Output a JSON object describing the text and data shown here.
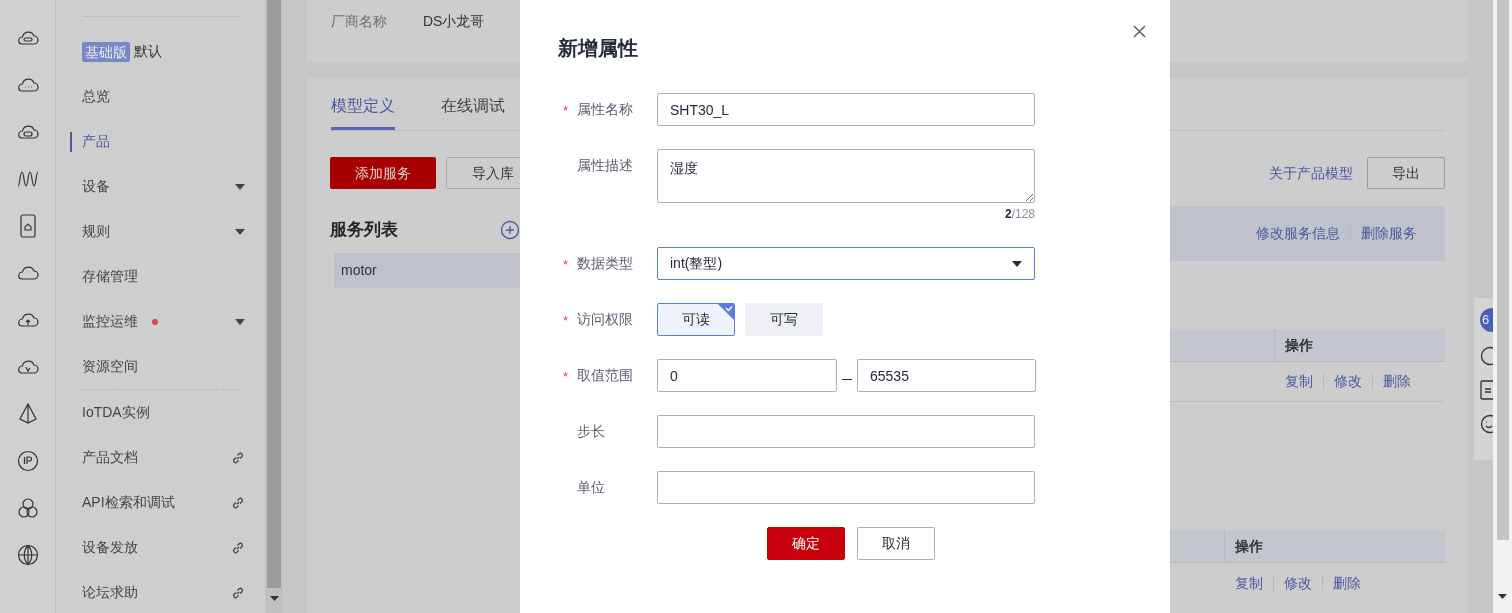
{
  "sidebar": {
    "edition_badge": "基础版",
    "edition_name": "默认",
    "items": [
      {
        "label": "总览",
        "kind": "plain",
        "selected": false,
        "alert": false,
        "divider_before": false
      },
      {
        "label": "产品",
        "kind": "plain",
        "selected": true,
        "alert": false,
        "divider_before": false
      },
      {
        "label": "设备",
        "kind": "menu",
        "selected": false,
        "alert": false,
        "divider_before": false
      },
      {
        "label": "规则",
        "kind": "menu",
        "selected": false,
        "alert": false,
        "divider_before": false
      },
      {
        "label": "存储管理",
        "kind": "plain",
        "selected": false,
        "alert": false,
        "divider_before": false
      },
      {
        "label": "监控运维",
        "kind": "menu",
        "selected": false,
        "alert": true,
        "divider_before": false
      },
      {
        "label": "资源空间",
        "kind": "plain",
        "selected": false,
        "alert": false,
        "divider_before": false
      },
      {
        "label": "IoTDA实例",
        "kind": "plain",
        "selected": false,
        "alert": false,
        "divider_before": true
      },
      {
        "label": "产品文档",
        "kind": "link",
        "selected": false,
        "alert": false,
        "divider_before": false
      },
      {
        "label": "API检索和调试",
        "kind": "link",
        "selected": false,
        "alert": false,
        "divider_before": false
      },
      {
        "label": "设备发放",
        "kind": "link",
        "selected": false,
        "alert": false,
        "divider_before": false
      },
      {
        "label": "论坛求助",
        "kind": "link",
        "selected": false,
        "alert": false,
        "divider_before": false
      }
    ]
  },
  "vendor": {
    "label": "厂商名称",
    "value": "DS小龙哥"
  },
  "tabs": [
    {
      "label": "模型定义",
      "selected": true
    },
    {
      "label": "在线调试",
      "selected": false
    }
  ],
  "toolbar": {
    "primary": "添加服务",
    "secondary": "导入库",
    "about_link": "关于产品模型",
    "export": "导出"
  },
  "service_list": {
    "title": "服务列表",
    "services": [
      {
        "name": "motor",
        "selected": true
      }
    ]
  },
  "service_actions": [
    "修改服务信息",
    "删除服务"
  ],
  "tables": [
    {
      "header": "操作",
      "row_actions": [
        "复制",
        "修改",
        "删除"
      ]
    },
    {
      "header": "操作",
      "row_actions": [
        "复制",
        "修改",
        "删除"
      ]
    }
  ],
  "dialog": {
    "title": "新增属性",
    "fields": [
      {
        "kind": "text",
        "label": "属性名称",
        "required": true,
        "value": "SHT30_L"
      },
      {
        "kind": "textarea",
        "label": "属性描述",
        "required": false,
        "value": "湿度",
        "counter": "**2**/128"
      },
      {
        "kind": "select",
        "label": "数据类型",
        "required": true,
        "value": "int(整型)"
      },
      {
        "kind": "toggle",
        "label": "访问权限",
        "required": true,
        "options": [
          {
            "label": "可读",
            "selected": true
          },
          {
            "label": "可写",
            "selected": false
          }
        ]
      },
      {
        "kind": "range",
        "label": "取值范围",
        "required": true,
        "min": "0",
        "max": "65535"
      },
      {
        "kind": "text",
        "label": "步长",
        "required": false
      },
      {
        "kind": "text",
        "label": "单位",
        "required": false
      }
    ],
    "required_mark": "*",
    "buttons": [
      {
        "label": "确定",
        "primary": true
      },
      {
        "label": "取消",
        "primary": false
      }
    ]
  },
  "help_panel": {
    "badge": "6"
  }
}
